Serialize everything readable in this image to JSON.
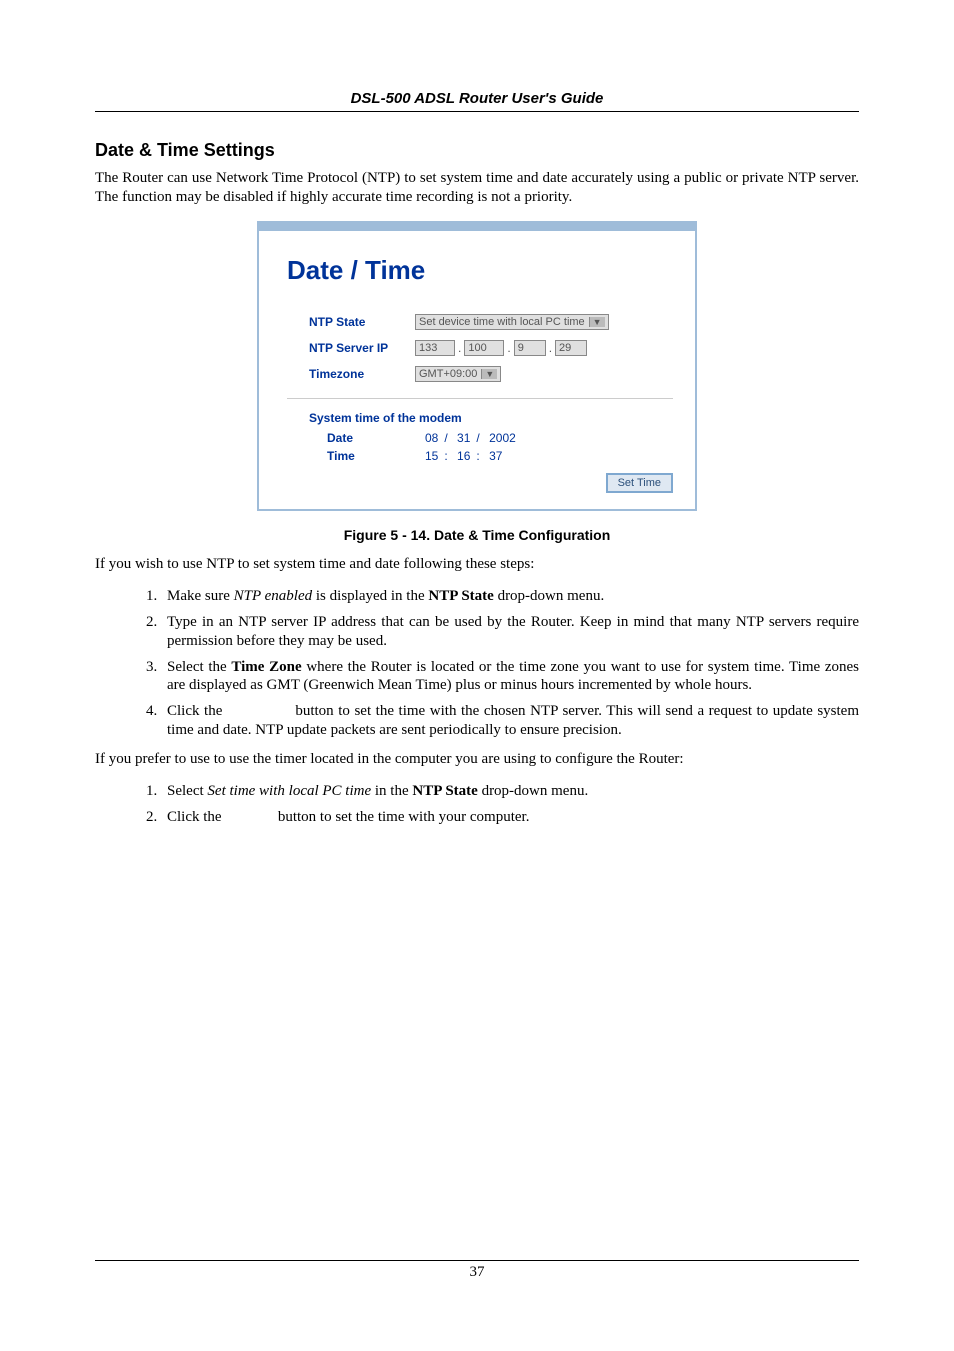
{
  "header": "DSL-500 ADSL Router User's Guide",
  "section_title": "Date & Time Settings",
  "intro_para": "The Router can use Network Time Protocol (NTP) to set system time and date accurately using a public or private NTP server. The function may be disabled if highly accurate time recording is not a priority.",
  "panel": {
    "title": "Date / Time",
    "labels": {
      "ntp_state": "NTP State",
      "ntp_server_ip": "NTP Server IP",
      "timezone": "Timezone"
    },
    "ntp_state_value": "Set device time with local PC time",
    "ip": {
      "a": "133",
      "b": "100",
      "c": "9",
      "d": "29"
    },
    "timezone_value": "GMT+09:00",
    "sub_head": "System time of the modem",
    "date_label": "Date",
    "time_label": "Time",
    "date": {
      "m": "08",
      "d": "31",
      "y": "2002"
    },
    "time": {
      "h": "15",
      "m": "16",
      "s": "37"
    },
    "button": "Set Time"
  },
  "figure_caption": "Figure 5 - 14. Date & Time Configuration",
  "after_fig_1": "If you wish to use NTP to set system time and date following these steps:",
  "steps_a": [
    "Make sure <i>NTP enabled</i> is displayed in the <b>NTP State</b> drop-down menu.",
    "Type in an NTP server IP address that can be used by the Router. Keep in mind that many NTP servers require permission before they may be used.",
    "Select the <b>Time Zone</b> where the Router is located or the time zone you want to use for system time. Time zones are displayed as GMT (Greenwich Mean Time) plus or minus hours incremented by whole hours.",
    "Click the                button to set the time with the chosen NTP server. This will send a request to update system time and date. NTP update packets are sent periodically to ensure precision."
  ],
  "after_fig_2": "If you prefer to use to use the timer located in the computer you are using to configure the Router:",
  "steps_b": [
    "Select <i>Set time with local PC time</i> in the <b>NTP State</b> drop-down menu.",
    "Click the               button to set the time with your computer."
  ],
  "page_number": "37"
}
